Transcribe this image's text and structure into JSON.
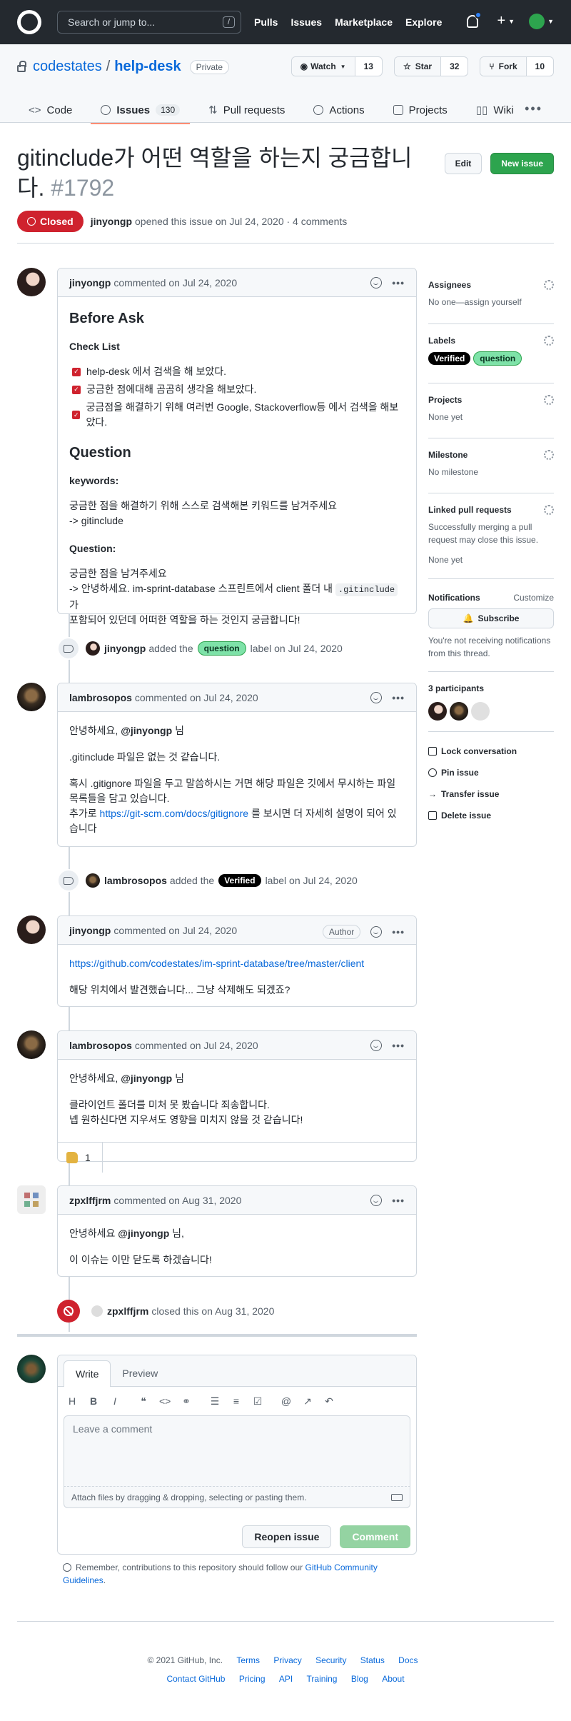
{
  "header": {
    "search_placeholder": "Search or jump to...",
    "search_key": "/",
    "nav": [
      "Pulls",
      "Issues",
      "Marketplace",
      "Explore"
    ]
  },
  "repo": {
    "owner": "codestates",
    "separator": "/",
    "name": "help-desk",
    "visibility": "Private",
    "watch_label": "Watch",
    "watch_count": "13",
    "star_label": "Star",
    "star_count": "32",
    "fork_label": "Fork",
    "fork_count": "10",
    "tabs": [
      {
        "label": "Code"
      },
      {
        "label": "Issues",
        "count": "130"
      },
      {
        "label": "Pull requests"
      },
      {
        "label": "Actions"
      },
      {
        "label": "Projects"
      },
      {
        "label": "Wiki"
      }
    ]
  },
  "issue": {
    "title": "gitinclude가 어떤 역할을 하는지 궁금합니다.",
    "number": "#1792",
    "edit_label": "Edit",
    "new_issue_label": "New issue",
    "state": "Closed",
    "author": "jinyongp",
    "meta_text": "opened this issue on Jul 24, 2020 · 4 comments"
  },
  "comments": [
    {
      "author": "jinyongp",
      "date": "commented on Jul 24, 2020",
      "h_before": "Before Ask",
      "h_checklist": "Check List",
      "checks": [
        "help-desk 에서 검색을 해 보았다.",
        "궁금한 점에대해 곰곰히 생각을 해보았다.",
        "궁금점을 해결하기 위해 여러번 Google, Stackoverflow등 에서 검색을 해보았다."
      ],
      "h_question": "Question",
      "h_keywords": "keywords:",
      "kw_line1": "궁금한 점을 해결하기 위해 스스로 검색해본 키워드를 남겨주세요",
      "kw_line2": "-> gitinclude",
      "h_question2": "Question:",
      "q_line1": "궁금한 점을 남겨주세요",
      "q_line2a": "-> 안녕하세요. im-sprint-database 스프린트에서 client 폴더 내",
      "q_code": ".gitinclude",
      "q_line2b": "가",
      "q_line3": "포함되어 있던데 어떠한 역할을 하는 것인지 궁금합니다!"
    },
    {
      "author": "lambrosopos",
      "date": "commented on Jul 24, 2020",
      "greet_a": "안녕하세요,",
      "mention": "@jinyongp",
      "greet_b": "님",
      "p1": ".gitinclude 파일은 없는 것 같습니다.",
      "p2": "혹시 .gitignore 파일을 두고 말씀하시는 거면 해당 파일은 깃에서 무시하는 파일 목록들을 담고 있습니다.",
      "p3a": "추가로",
      "link": "https://git-scm.com/docs/gitignore",
      "p3b": "를 보시면 더 자세히 설명이 되어 있습니다"
    },
    {
      "author": "jinyongp",
      "date": "commented on Jul 24, 2020",
      "badge": "Author",
      "link": "https://github.com/codestates/im-sprint-database/tree/master/client",
      "text": "해당 위치에서 발견했습니다... 그냥 삭제해도 되겠죠?"
    },
    {
      "author": "lambrosopos",
      "date": "commented on Jul 24, 2020",
      "greet_a": "안녕하세요,",
      "mention": "@jinyongp",
      "greet_b": "님",
      "line1": "클라이언트 폴더를 미처 못 봤습니다 죄송합니다.",
      "line2": "넵 원하신다면 지우셔도 영향을 미치지 않을 것 같습니다!",
      "reaction_count": "1"
    },
    {
      "author": "zpxlffjrm",
      "date": "commented on Aug 31, 2020",
      "greet": "안녕하세요",
      "mention": "@jinyongp",
      "greet_b": "님,",
      "text": "이 이슈는 이만 닫도록 하겠습니다!"
    }
  ],
  "events": [
    {
      "actor": "jinyongp",
      "pre": "added the",
      "label": "question",
      "post": "label on Jul 24, 2020"
    },
    {
      "actor": "lambrosopos",
      "pre": "added the",
      "label": "Verified",
      "post": "label on Jul 24, 2020"
    },
    {
      "actor": "zpxlffjrm",
      "text": "closed this on Aug 31, 2020"
    }
  ],
  "sidebar": {
    "assignees_title": "Assignees",
    "assignees_text": "No one—assign yourself",
    "labels_title": "Labels",
    "labels": [
      "Verified",
      "question"
    ],
    "projects_title": "Projects",
    "projects_text": "None yet",
    "milestone_title": "Milestone",
    "milestone_text": "No milestone",
    "linked_title": "Linked pull requests",
    "linked_text": "Successfully merging a pull request may close this issue.",
    "linked_none": "None yet",
    "notif_title": "Notifications",
    "customize": "Customize",
    "subscribe": "Subscribe",
    "notif_text": "You're not receiving notifications from this thread.",
    "participants": "3 participants",
    "actions": [
      "Lock conversation",
      "Pin issue",
      "Transfer issue",
      "Delete issue"
    ]
  },
  "composer": {
    "write_tab": "Write",
    "preview_tab": "Preview",
    "placeholder": "Leave a comment",
    "attach": "Attach files by dragging & dropping, selecting or pasting them.",
    "reopen": "Reopen issue",
    "comment": "Comment",
    "remind_a": "Remember, contributions to this repository should follow our",
    "remind_link": "GitHub Community Guidelines",
    "remind_b": "."
  },
  "footer": {
    "copyright": "© 2021 GitHub, Inc.",
    "row1": [
      "Terms",
      "Privacy",
      "Security",
      "Status",
      "Docs"
    ],
    "row2": [
      "Contact GitHub",
      "Pricing",
      "API",
      "Training",
      "Blog",
      "About"
    ]
  },
  "colors": {
    "closed": "#cf222e",
    "primary": "#2da44e",
    "link": "#0969da",
    "tab_underline": "#fd8c73"
  }
}
